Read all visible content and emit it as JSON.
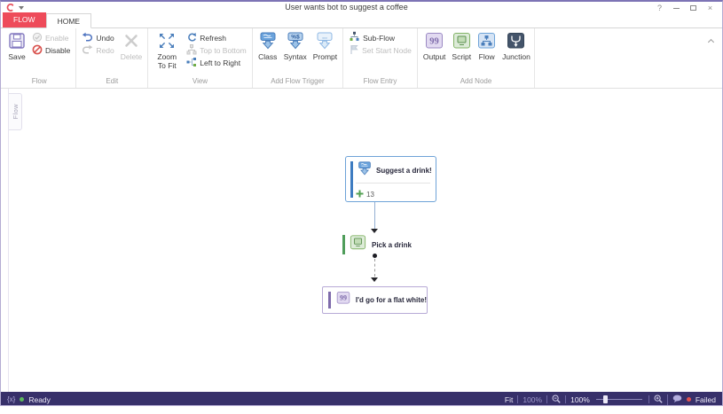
{
  "window": {
    "title": "User wants bot to suggest a coffee",
    "controls": {
      "help": "?",
      "close": "×"
    }
  },
  "tabs": [
    {
      "label": "FLOW"
    },
    {
      "label": "HOME"
    }
  ],
  "ribbon": {
    "groups": [
      {
        "label": "Flow",
        "buttons": {
          "save": "Save",
          "enable": "Enable",
          "disable": "Disable"
        }
      },
      {
        "label": "Edit",
        "buttons": {
          "undo": "Undo",
          "redo": "Redo",
          "delete": "Delete"
        }
      },
      {
        "label": "View",
        "buttons": {
          "zoom_to_fit": "Zoom To Fit",
          "refresh": "Refresh",
          "top_to_bottom": "Top to Bottom",
          "left_to_right": "Left to Right"
        }
      },
      {
        "label": "Add Flow Trigger",
        "buttons": {
          "class": "Class",
          "syntax": "Syntax",
          "prompt": "Prompt"
        }
      },
      {
        "label": "Flow Entry",
        "buttons": {
          "sub_flow": "Sub-Flow",
          "set_start_node": "Set Start Node"
        }
      },
      {
        "label": "Add Node",
        "buttons": {
          "output": "Output",
          "script": "Script",
          "flow": "Flow",
          "junction": "Junction"
        }
      }
    ]
  },
  "canvas": {
    "side_tab": "Flow",
    "nodes": {
      "trigger": {
        "title": "Suggest a drink!",
        "transition_count": "13"
      },
      "script": {
        "title": "Pick a drink"
      },
      "output": {
        "title": "I'd go for a flat white!"
      }
    }
  },
  "status_bar": {
    "ready": "Ready",
    "variables_glyph": "{x}",
    "fit": "Fit",
    "fit_zoom": "100%",
    "zoom": "100%",
    "failed": "Failed"
  },
  "colors": {
    "flow_tab": "#ee4b5a",
    "status_bar": "#37306a",
    "accent_blue": "#4a7ebb",
    "node_blue_border": "#6ea3d8",
    "node_blue_bar": "#3e7cc1",
    "node_green": "#4f9d5a",
    "node_purple_border": "#b7aad6",
    "node_purple_bar": "#7e6bab",
    "ready_green": "#5cb85c",
    "failed_red": "#e0514f"
  }
}
